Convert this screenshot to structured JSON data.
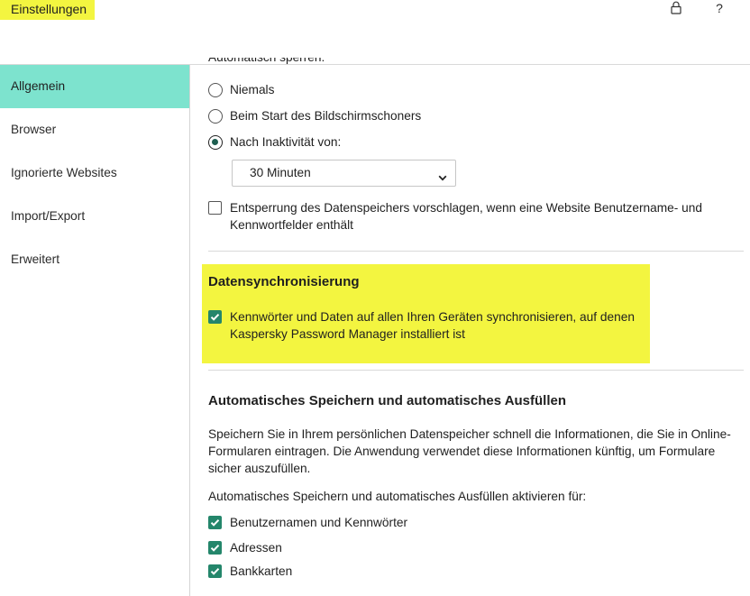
{
  "header": {
    "title": "Einstellungen",
    "lock_icon": "lock-icon",
    "help_icon": "help-icon",
    "help_glyph": "?"
  },
  "sidebar": {
    "items": [
      {
        "label": "Allgemein",
        "selected": true
      },
      {
        "label": "Browser",
        "selected": false
      },
      {
        "label": "Ignorierte Websites",
        "selected": false
      },
      {
        "label": "Import/Export",
        "selected": false
      },
      {
        "label": "Erweitert",
        "selected": false
      }
    ]
  },
  "general": {
    "auto_lock": {
      "heading": "Automatisch sperren:",
      "options": [
        {
          "label": "Niemals",
          "selected": false
        },
        {
          "label": "Beim Start des Bildschirmschoners",
          "selected": false
        },
        {
          "label": "Nach Inaktivität von:",
          "selected": true
        }
      ],
      "inactivity_value": "30 Minuten",
      "dropdown_icon": "chevron-down-icon"
    },
    "unlock_suggestion": {
      "checked": false,
      "lines": [
        "Entsperrung des Datenspeichers vorschlagen, wenn eine Website Benutzername- und",
        "Kennwortfelder enthält"
      ]
    },
    "sync": {
      "title": "Datensynchronisierung",
      "checked": true,
      "lines": [
        "Kennwörter und Daten auf allen Ihren Geräten synchronisieren, auf denen",
        "Kaspersky Password Manager installiert ist"
      ]
    },
    "autofill": {
      "title": "Automatisches Speichern und automatisches Ausfüllen",
      "description_lines": [
        "Speichern Sie in Ihrem persönlichen Datenspeicher schnell die Informationen, die Sie in Online-",
        "Formularen eintragen. Die Anwendung verwendet diese Informationen künftig, um Formulare",
        "sicher auszufüllen."
      ],
      "enable_label": "Automatisches Speichern und automatisches Ausfüllen aktivieren für:",
      "options": [
        {
          "label": "Benutzernamen und Kennwörter",
          "checked": true
        },
        {
          "label": "Adressen",
          "checked": true
        },
        {
          "label": "Bankkarten",
          "checked": true
        }
      ],
      "check_icon": "check-icon"
    }
  },
  "colors": {
    "accent": "#7de3ce",
    "highlight": "#f3f540",
    "check": "#24866b"
  }
}
